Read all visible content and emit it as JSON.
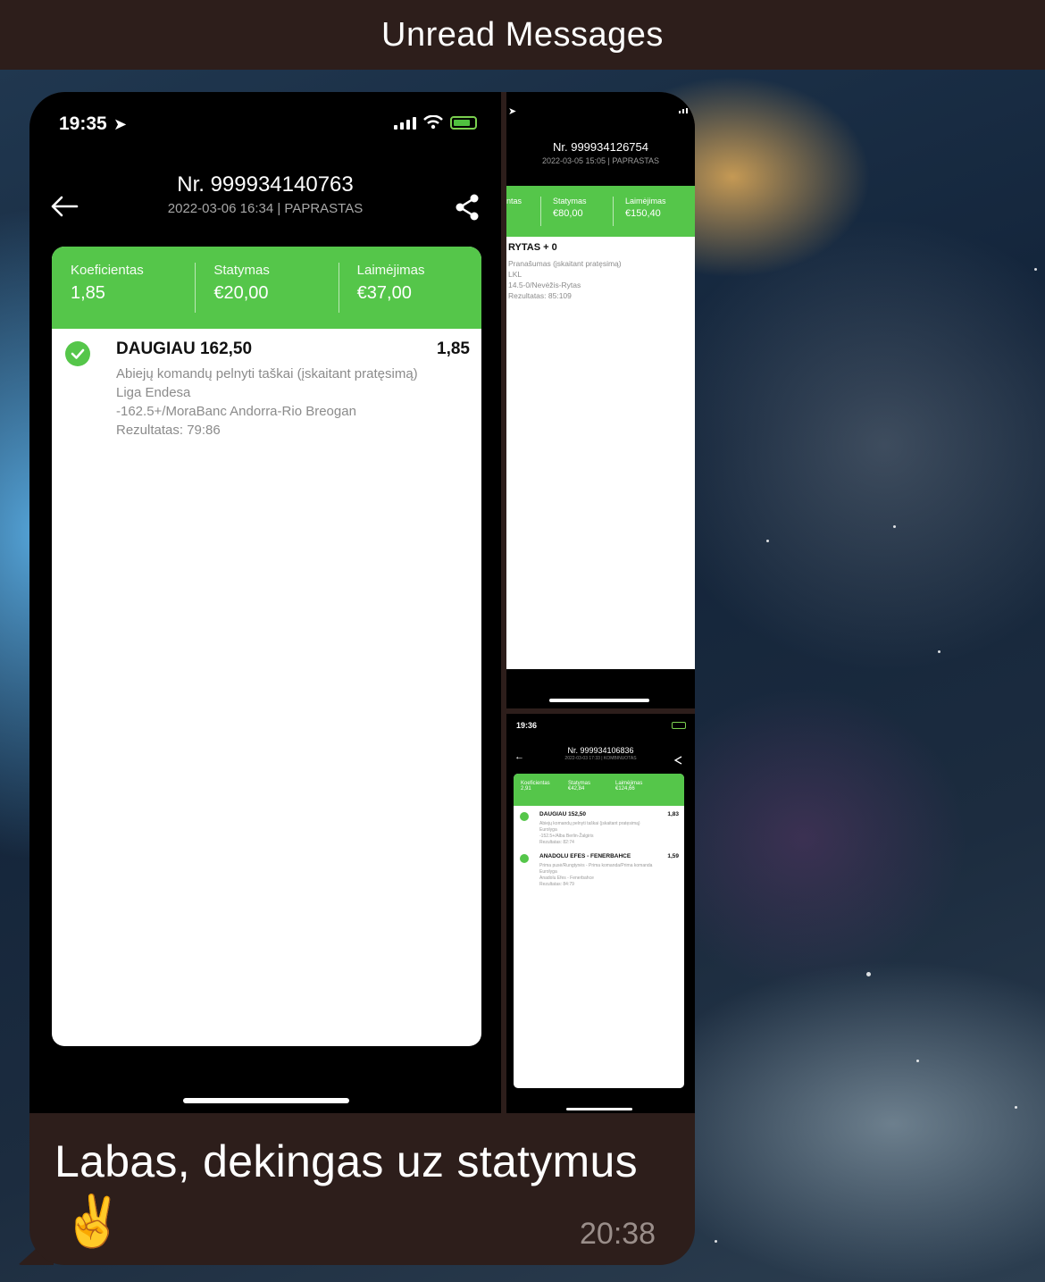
{
  "topbar": {
    "title": "Unread Messages"
  },
  "screenshot_main": {
    "status_time": "19:35",
    "ticket_nr": "Nr. 999934140763",
    "ticket_meta": "2022-03-06 16:34 | PAPRASTAS",
    "summary": [
      {
        "label": "Koeficientas",
        "value": "1,85"
      },
      {
        "label": "Statymas",
        "value": "€20,00"
      },
      {
        "label": "Laimėjimas",
        "value": "€37,00"
      }
    ],
    "bet": {
      "title": "DAUGIAU 162,50",
      "odd": "1,85",
      "lines": [
        "Abiejų komandų pelnyti taškai (įskaitant pratęsimą)",
        "Liga Endesa",
        "-162.5+/MoraBanc Andorra-Rio Breogan",
        "Rezultatas: 79:86"
      ]
    }
  },
  "screenshot_right_top": {
    "ticket_nr": "Nr. 999934126754",
    "ticket_meta": "2022-03-05 15:05 | PAPRASTAS",
    "summary": [
      {
        "label": "ntas",
        "value": ""
      },
      {
        "label": "Statymas",
        "value": "€80,00"
      },
      {
        "label": "Laimėjimas",
        "value": "€150,40"
      }
    ],
    "bet": {
      "title": "RYTAS + 0",
      "lines": [
        "Pranašumas (įskaitant pratęsimą)",
        "LKL",
        "14.5-0/Nevėžis-Rytas",
        "Rezultatas: 85:109"
      ]
    }
  },
  "screenshot_right_bottom": {
    "status_time": "19:36",
    "ticket_nr": "Nr. 999934106836",
    "ticket_meta": "2022-03-03 17:33 | KOMBINUOTAS",
    "summary": [
      {
        "label": "Koeficientas",
        "value": "2,91"
      },
      {
        "label": "Statymas",
        "value": "€42,84"
      },
      {
        "label": "Laimėjimas",
        "value": "€124,66"
      }
    ],
    "bets": [
      {
        "title": "DAUGIAU 152,50",
        "odd": "1,83",
        "lines": [
          "Abiejų komandų pelnyti taškai (įskaitant pratęsimą)",
          "Eurolyga",
          "-152.5+/Alba Berlin-Žalgiris",
          "Rezultatas: 82:74"
        ]
      },
      {
        "title": "ANADOLU EFES - FENERBAHCE",
        "odd": "1,59",
        "lines": [
          "Prima pusė/Rungtynės - Prima komanda/Prima komanda",
          "Eurolyga",
          "Anadolu Efes - Fenerbahce",
          "Rezultatas: 84:79"
        ]
      }
    ]
  },
  "message": {
    "text": "Labas, dekingas uz statymus",
    "emoji": "✌️",
    "time": "20:38"
  },
  "colors": {
    "bubble": "#2d1e1b",
    "green": "#55c64a"
  }
}
